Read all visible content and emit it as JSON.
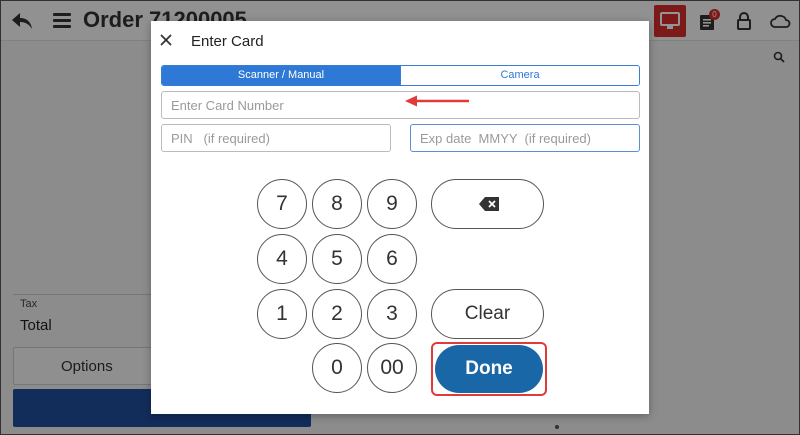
{
  "app": {
    "order_title": "Order 71200005",
    "notification_count": "0",
    "tax_label": "Tax",
    "total_label": "Total",
    "options_label": "Options"
  },
  "modal": {
    "title": "Enter Card",
    "tabs": [
      {
        "label": "Scanner / Manual",
        "active": true
      },
      {
        "label": "Camera",
        "active": false
      }
    ],
    "card_number_placeholder": "Enter Card Number",
    "card_number_value": "",
    "pin_placeholder": "PIN   (if required)",
    "pin_value": "",
    "exp_placeholder": "Exp date  MMYY  (if required)",
    "exp_value": ""
  },
  "keypad": {
    "keys": [
      "7",
      "8",
      "9",
      "4",
      "5",
      "6",
      "1",
      "2",
      "3",
      "0",
      "00"
    ],
    "clear_label": "Clear",
    "done_label": "Done"
  },
  "colors": {
    "accent": "#2f79d6",
    "done": "#1a67a8",
    "highlight": "#e03a3a",
    "alert": "#d62c2c"
  },
  "icons": [
    "back-arrow-icon",
    "hamburger-menu-icon",
    "monitor-icon",
    "receipt-icon",
    "lock-icon",
    "cloud-icon",
    "search-icon",
    "close-icon",
    "backspace-icon"
  ]
}
